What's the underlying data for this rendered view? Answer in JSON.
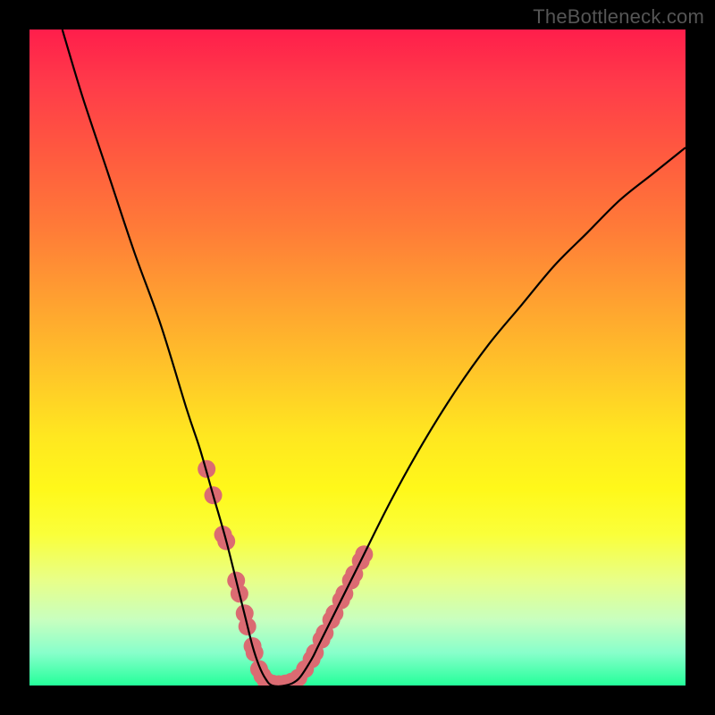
{
  "watermark": "TheBottleneck.com",
  "chart_data": {
    "type": "line",
    "title": "",
    "xlabel": "",
    "ylabel": "",
    "xlim": [
      0,
      100
    ],
    "ylim": [
      0,
      100
    ],
    "series": [
      {
        "name": "curve",
        "color": "#000000",
        "x": [
          5,
          8,
          12,
          16,
          20,
          24,
          26,
          28,
          30,
          32,
          33,
          34,
          35,
          36,
          37,
          39,
          41,
          43,
          44,
          46,
          50,
          55,
          60,
          65,
          70,
          75,
          80,
          85,
          90,
          95,
          100
        ],
        "y": [
          100,
          90,
          78,
          66,
          55,
          42,
          36,
          29,
          22,
          14,
          10,
          6,
          3,
          1,
          0,
          0,
          1,
          4,
          6,
          10,
          18,
          28,
          37,
          45,
          52,
          58,
          64,
          69,
          74,
          78,
          82
        ]
      }
    ],
    "markers": {
      "name": "highlight-points",
      "color": "#db6b72",
      "radius": 10,
      "points": [
        {
          "x": 27,
          "y": 33
        },
        {
          "x": 28,
          "y": 29
        },
        {
          "x": 29.5,
          "y": 23
        },
        {
          "x": 30,
          "y": 22
        },
        {
          "x": 31.5,
          "y": 16
        },
        {
          "x": 32,
          "y": 14
        },
        {
          "x": 32.8,
          "y": 11
        },
        {
          "x": 33.2,
          "y": 9
        },
        {
          "x": 34,
          "y": 6
        },
        {
          "x": 34.3,
          "y": 5
        },
        {
          "x": 35,
          "y": 2.5
        },
        {
          "x": 35.5,
          "y": 1.5
        },
        {
          "x": 36,
          "y": 0.8
        },
        {
          "x": 37,
          "y": 0.3
        },
        {
          "x": 38,
          "y": 0.2
        },
        {
          "x": 39,
          "y": 0.3
        },
        {
          "x": 40,
          "y": 0.6
        },
        {
          "x": 41,
          "y": 1.2
        },
        {
          "x": 42,
          "y": 2.5
        },
        {
          "x": 43,
          "y": 4
        },
        {
          "x": 43.5,
          "y": 5
        },
        {
          "x": 44.5,
          "y": 7
        },
        {
          "x": 45,
          "y": 8
        },
        {
          "x": 46,
          "y": 10
        },
        {
          "x": 46.5,
          "y": 11
        },
        {
          "x": 47.5,
          "y": 13
        },
        {
          "x": 48,
          "y": 14
        },
        {
          "x": 49,
          "y": 16
        },
        {
          "x": 49.5,
          "y": 17
        },
        {
          "x": 50.5,
          "y": 19
        },
        {
          "x": 51,
          "y": 20
        }
      ]
    }
  }
}
